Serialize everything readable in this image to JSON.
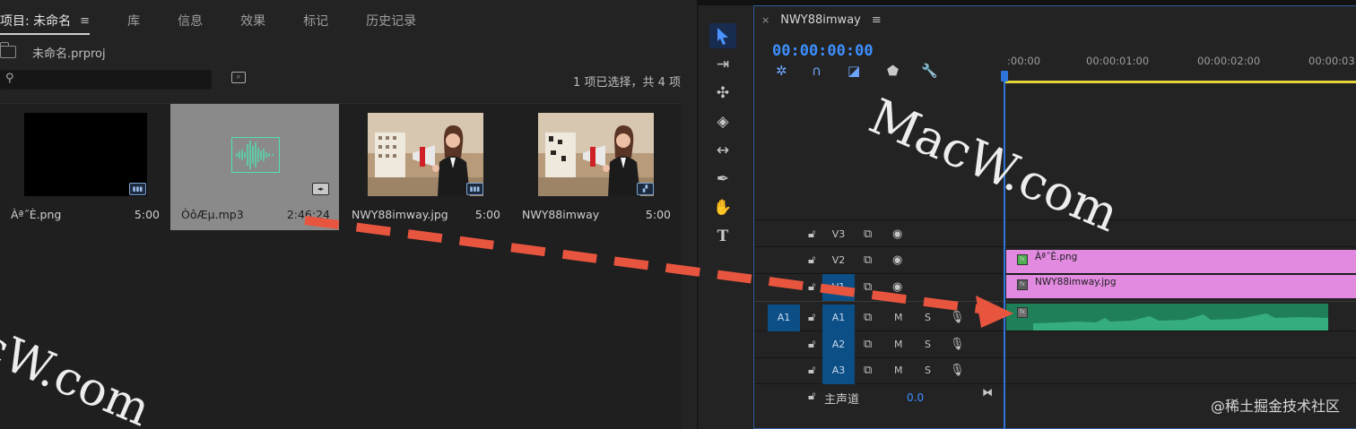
{
  "project": {
    "tabs": [
      {
        "label": "项目: 未命名",
        "active": true
      },
      {
        "label": "库"
      },
      {
        "label": "信息"
      },
      {
        "label": "效果"
      },
      {
        "label": "标记"
      },
      {
        "label": "历史记录"
      }
    ],
    "menu_glyph": "≡",
    "file_name": "未命名.prproj",
    "search_placeholder": "",
    "selection_info": "1 项已选择，共 4 项",
    "items": [
      {
        "name": "Àª˝È.png",
        "duration": "5:00",
        "kind": "black-frame"
      },
      {
        "name": "ÒôÆµ.mp3",
        "duration": "2:46:24",
        "kind": "audio",
        "selected": true
      },
      {
        "name": "NWY88imway.jpg",
        "duration": "5:00",
        "kind": "photo"
      },
      {
        "name": "NWY88imway",
        "duration": "5:00",
        "kind": "sequence"
      }
    ]
  },
  "tools": [
    "selection-tool",
    "track-select-tool",
    "ripple-edit-tool",
    "razor-tool",
    "slip-tool",
    "pen-tool",
    "hand-tool",
    "type-tool"
  ],
  "timeline": {
    "sequence_name": "NWY88imway",
    "close_glyph": "×",
    "timecode": "00:00:00:00",
    "ruler": [
      ":00:00",
      "00:00:01:00",
      "00:00:02:00",
      "00:00:03:"
    ],
    "tracks": {
      "video": [
        {
          "label": "V3"
        },
        {
          "label": "V2"
        },
        {
          "label": "V1"
        }
      ],
      "audio": [
        {
          "label": "A1",
          "source": "A1",
          "m": "M",
          "s": "S"
        },
        {
          "label": "A2",
          "m": "M",
          "s": "S"
        },
        {
          "label": "A3",
          "m": "M",
          "s": "S"
        }
      ]
    },
    "clips": {
      "v2": "Àª˝È.png",
      "v1": "NWY88imway.jpg"
    },
    "master_label": "主声道",
    "master_value": "0.0"
  },
  "watermark": "MacW.com",
  "watermark_partial": "cW.com",
  "credit": "@稀土掘金技术社区",
  "colors": {
    "accent": "#3d8fff",
    "video_clip": "#e18ae0",
    "audio_clip": "#1e7f59",
    "arrow": "#e8553f",
    "selected_item": "#8a8a8a"
  }
}
